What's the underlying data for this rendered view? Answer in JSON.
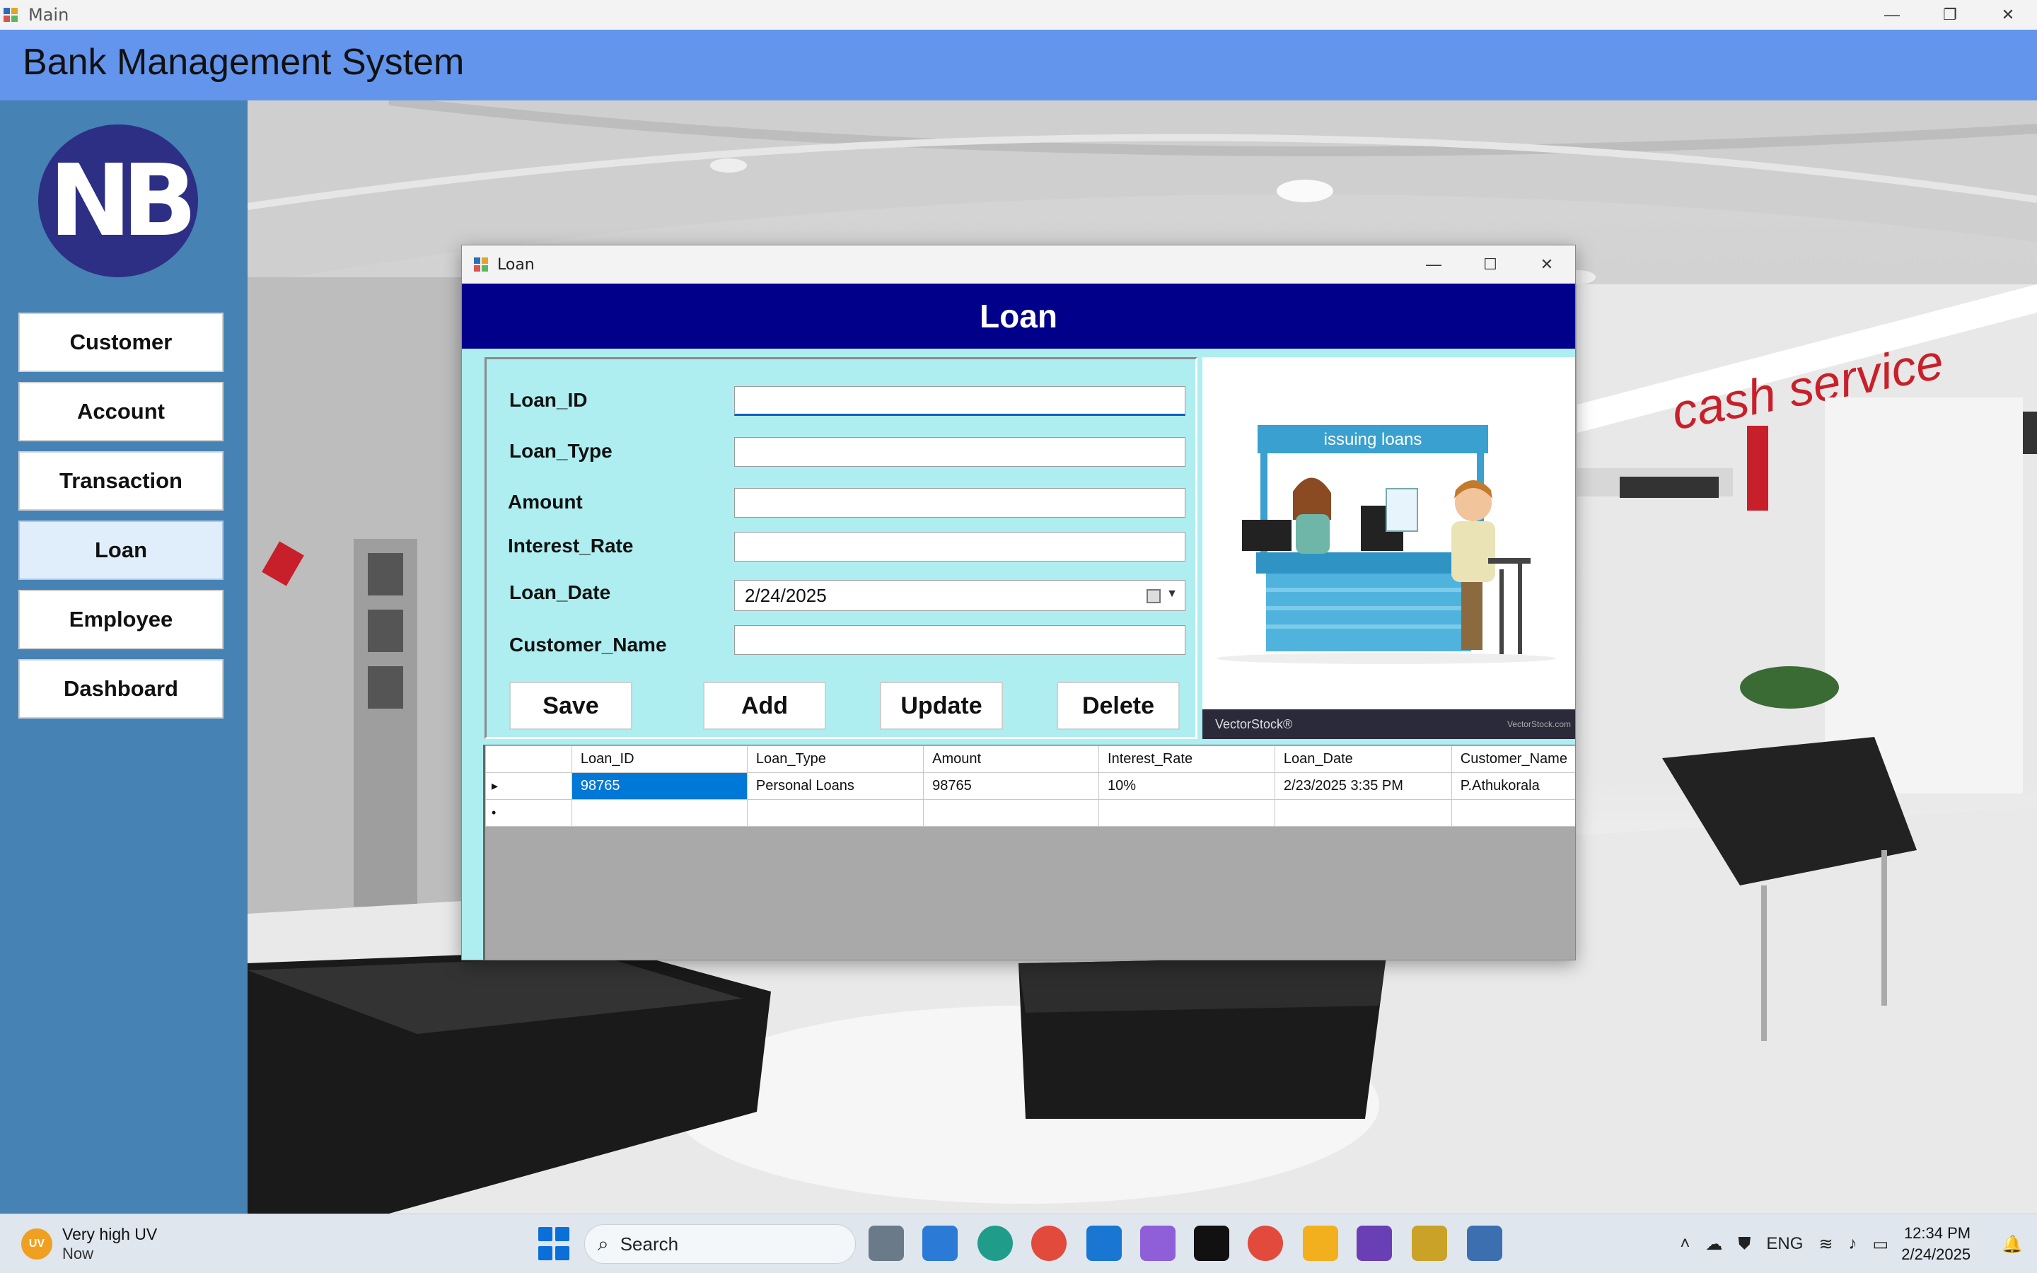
{
  "main_window": {
    "title": "Main",
    "app_title": "Bank Management System",
    "logo_text": "NB",
    "controls": {
      "minimize": "—",
      "restore": "❐",
      "close": "✕"
    }
  },
  "sidebar": {
    "items": [
      {
        "label": "Customer",
        "active": false
      },
      {
        "label": "Account",
        "active": false
      },
      {
        "label": "Transaction",
        "active": false
      },
      {
        "label": "Loan",
        "active": true
      },
      {
        "label": "Employee",
        "active": false
      },
      {
        "label": "Dashboard",
        "active": false
      }
    ]
  },
  "background": {
    "sign_text": "cash service"
  },
  "loan_window": {
    "title": "Loan",
    "header": "Loan",
    "controls": {
      "minimize": "—",
      "maximize": "☐",
      "close": "✕"
    },
    "fields": {
      "loan_id": {
        "label": "Loan_ID",
        "value": ""
      },
      "loan_type": {
        "label": "Loan_Type",
        "value": ""
      },
      "amount": {
        "label": "Amount",
        "value": ""
      },
      "interest_rate": {
        "label": "Interest_Rate",
        "value": ""
      },
      "loan_date": {
        "label": "Loan_Date",
        "value": "2/24/2025"
      },
      "customer_name": {
        "label": "Customer_Name",
        "value": ""
      }
    },
    "buttons": {
      "save": "Save",
      "add": "Add",
      "update": "Update",
      "delete": "Delete"
    },
    "image": {
      "banner": "issuing loans",
      "watermark": "VectorStock®",
      "watermark_small": "VectorStock.com"
    },
    "grid": {
      "columns": [
        "Loan_ID",
        "Loan_Type",
        "Amount",
        "Interest_Rate",
        "Loan_Date",
        "Customer_Name"
      ],
      "rows": [
        {
          "indicator": "▸",
          "cells": [
            "98765",
            "Personal Loans",
            "98765",
            "10%",
            "2/23/2025 3:35 PM",
            "P.Athukorala"
          ]
        }
      ],
      "new_row_indicator": "•"
    }
  },
  "taskbar": {
    "weather": {
      "badge": "UV",
      "line1": "Very high UV",
      "line2": "Now"
    },
    "search_placeholder": "Search",
    "tray": {
      "language": "ENG",
      "time": "12:34 PM",
      "date": "2/24/2025"
    }
  },
  "colors": {
    "header_band": "#6495ed",
    "sidebar": "#4682b4",
    "loan_header": "#00008b",
    "form_bg": "#aeeef0",
    "selection": "#0078d7"
  }
}
